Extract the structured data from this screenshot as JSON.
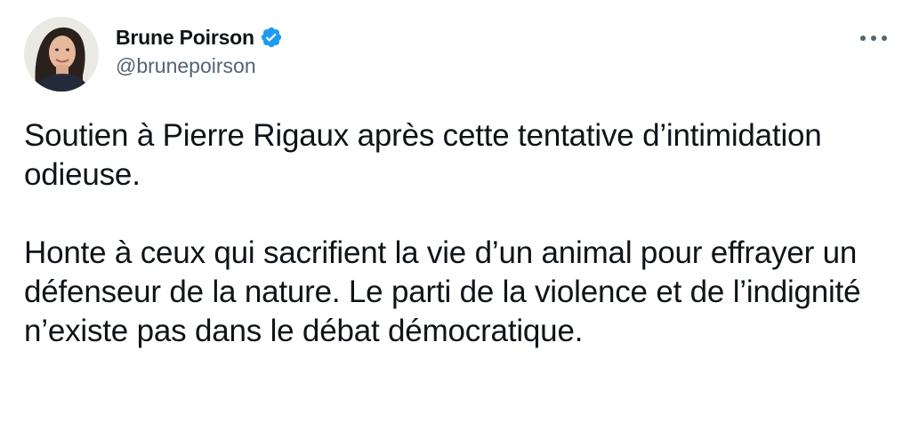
{
  "tweet": {
    "author": {
      "display_name": "Brune Poirson",
      "handle": "@brunepoirson",
      "verified": true
    },
    "paragraphs": [
      "Soutien à Pierre Rigaux après cette tentative d’intimidation odieuse.",
      "Honte à ceux qui sacrifient la vie d’un animal pour effrayer un défenseur de la nature. Le parti de la violence et de l’indignité n’existe pas dans le débat démocratique."
    ]
  },
  "icons": {
    "verified": "verified-badge-icon",
    "more": "more-options-icon"
  },
  "colors": {
    "text_primary": "#0f1419",
    "text_secondary": "#536471",
    "verified_blue": "#1d9bf0",
    "background": "#ffffff"
  }
}
